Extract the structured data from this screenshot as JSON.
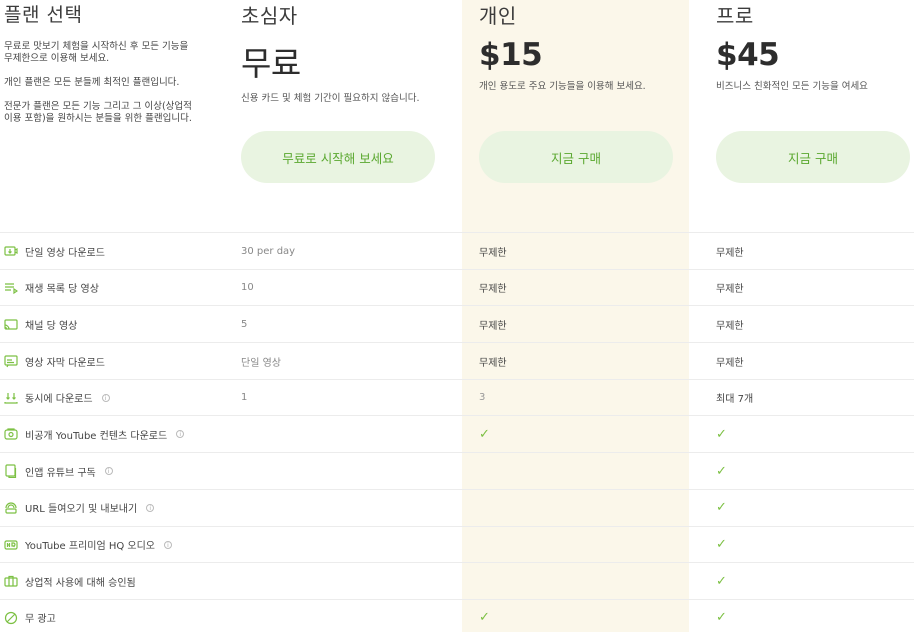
{
  "intro": {
    "title": "플랜 선택",
    "text1": "무료로 맛보기 체험을 시작하신 후 모든 기능을 무제한으로 이용해 보세요.",
    "text2": "개인 플랜은 모든 분들께 최적인 플랜입니다.",
    "text3": "전문가 플랜은 모든 기능 그리고 그 이상(상업적 이용 포함)을 원하시는 분들을 위한 플랜입니다."
  },
  "plans": [
    {
      "name": "초심자",
      "price": "무료",
      "desc": "신용 카드 및 체험 기간이 필요하지 않습니다.",
      "cta": "무료로 시작해 보세요"
    },
    {
      "name": "개인",
      "price": "$15",
      "desc": "개인 용도로 주요 기능들을 이용해 보세요.",
      "cta": "지금 구매"
    },
    {
      "name": "프로",
      "price": "$45",
      "desc": "비즈니스 친화적인 모든 기능을 여세요",
      "cta": "지금 구매"
    }
  ],
  "accent": "#7cc043",
  "highlight_bg": "#fbf7ea",
  "features": [
    {
      "label": "단일 영상 다운로드",
      "icon": "video-download-icon",
      "info": false,
      "starter": "30 per day",
      "personal": "무제한",
      "pro": "무제한"
    },
    {
      "label": "재생 목록 당 영상",
      "icon": "playlist-icon",
      "info": false,
      "starter": "10",
      "personal": "무제한",
      "pro": "무제한"
    },
    {
      "label": "채널 당 영상",
      "icon": "channel-icon",
      "info": false,
      "starter": "5",
      "personal": "무제한",
      "pro": "무제한"
    },
    {
      "label": "영상 자막 다운로드",
      "icon": "subtitles-icon",
      "info": false,
      "starter": "단일 영상",
      "personal": "무제한",
      "pro": "무제한"
    },
    {
      "label": "동시에 다운로드",
      "icon": "simultaneous-download-icon",
      "info": true,
      "starter": "1",
      "personal": "3",
      "pro": "최대 7개"
    },
    {
      "label": "비공개 YouTube 컨텐츠 다운로드",
      "icon": "private-content-icon",
      "info": true,
      "starter": "",
      "personal": "✓",
      "pro": "✓"
    },
    {
      "label": "인앱 유튜브 구독",
      "icon": "subscription-icon",
      "info": true,
      "starter": "",
      "personal": "",
      "pro": "✓"
    },
    {
      "label": "URL 들여오기 및 내보내기",
      "icon": "url-import-icon",
      "info": true,
      "starter": "",
      "personal": "",
      "pro": "✓"
    },
    {
      "label": "YouTube 프리미엄 HQ 오디오",
      "icon": "hq-audio-icon",
      "info": true,
      "starter": "",
      "personal": "",
      "pro": "✓"
    },
    {
      "label": "상업적 사용에 대해 승인됨",
      "icon": "briefcase-icon",
      "info": false,
      "starter": "",
      "personal": "",
      "pro": "✓"
    },
    {
      "label": "무 광고",
      "icon": "no-ads-icon",
      "info": false,
      "starter": "",
      "personal": "✓",
      "pro": "✓"
    }
  ]
}
